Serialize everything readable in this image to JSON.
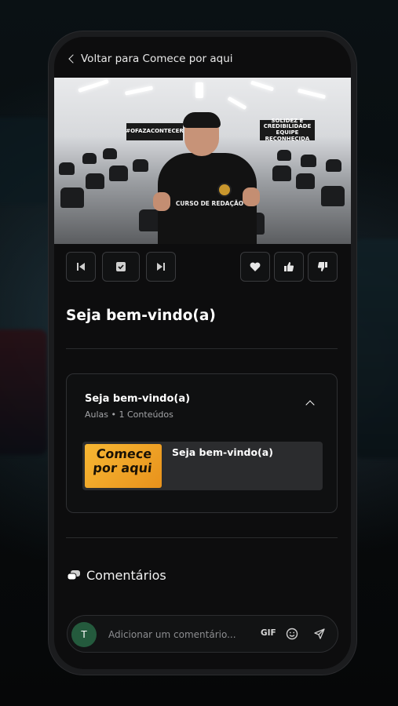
{
  "header": {
    "back_label": "Voltar para Comece por aqui"
  },
  "video": {
    "banner_left": "#OFAZACONTECER",
    "banner_right": "SOLIDEZ E CREDIBILIDADE EQUIPE RECONHECIDA",
    "shirt_text": "CURSO DE REDAÇÃO"
  },
  "controls": {
    "icons": [
      "skip-previous-icon",
      "check-square-icon",
      "skip-next-icon",
      "heart-icon",
      "thumbs-up-icon",
      "thumbs-down-icon"
    ]
  },
  "lesson": {
    "title": "Seja bem-vindo(a)"
  },
  "module": {
    "title": "Seja bem-vindo(a)",
    "subtitle": "Aulas • 1 Conteúdos",
    "items": [
      {
        "thumb_text": "Comece por aqui",
        "title": "Seja bem-vindo(a)"
      }
    ]
  },
  "comments": {
    "heading": "Comentários",
    "avatar_initial": "T",
    "placeholder": "Adicionar um comentário...",
    "gif_label": "GIF"
  },
  "colors": {
    "background": "#0d0d0e",
    "avatar": "#245a3d",
    "thumb": "#f7b733"
  }
}
